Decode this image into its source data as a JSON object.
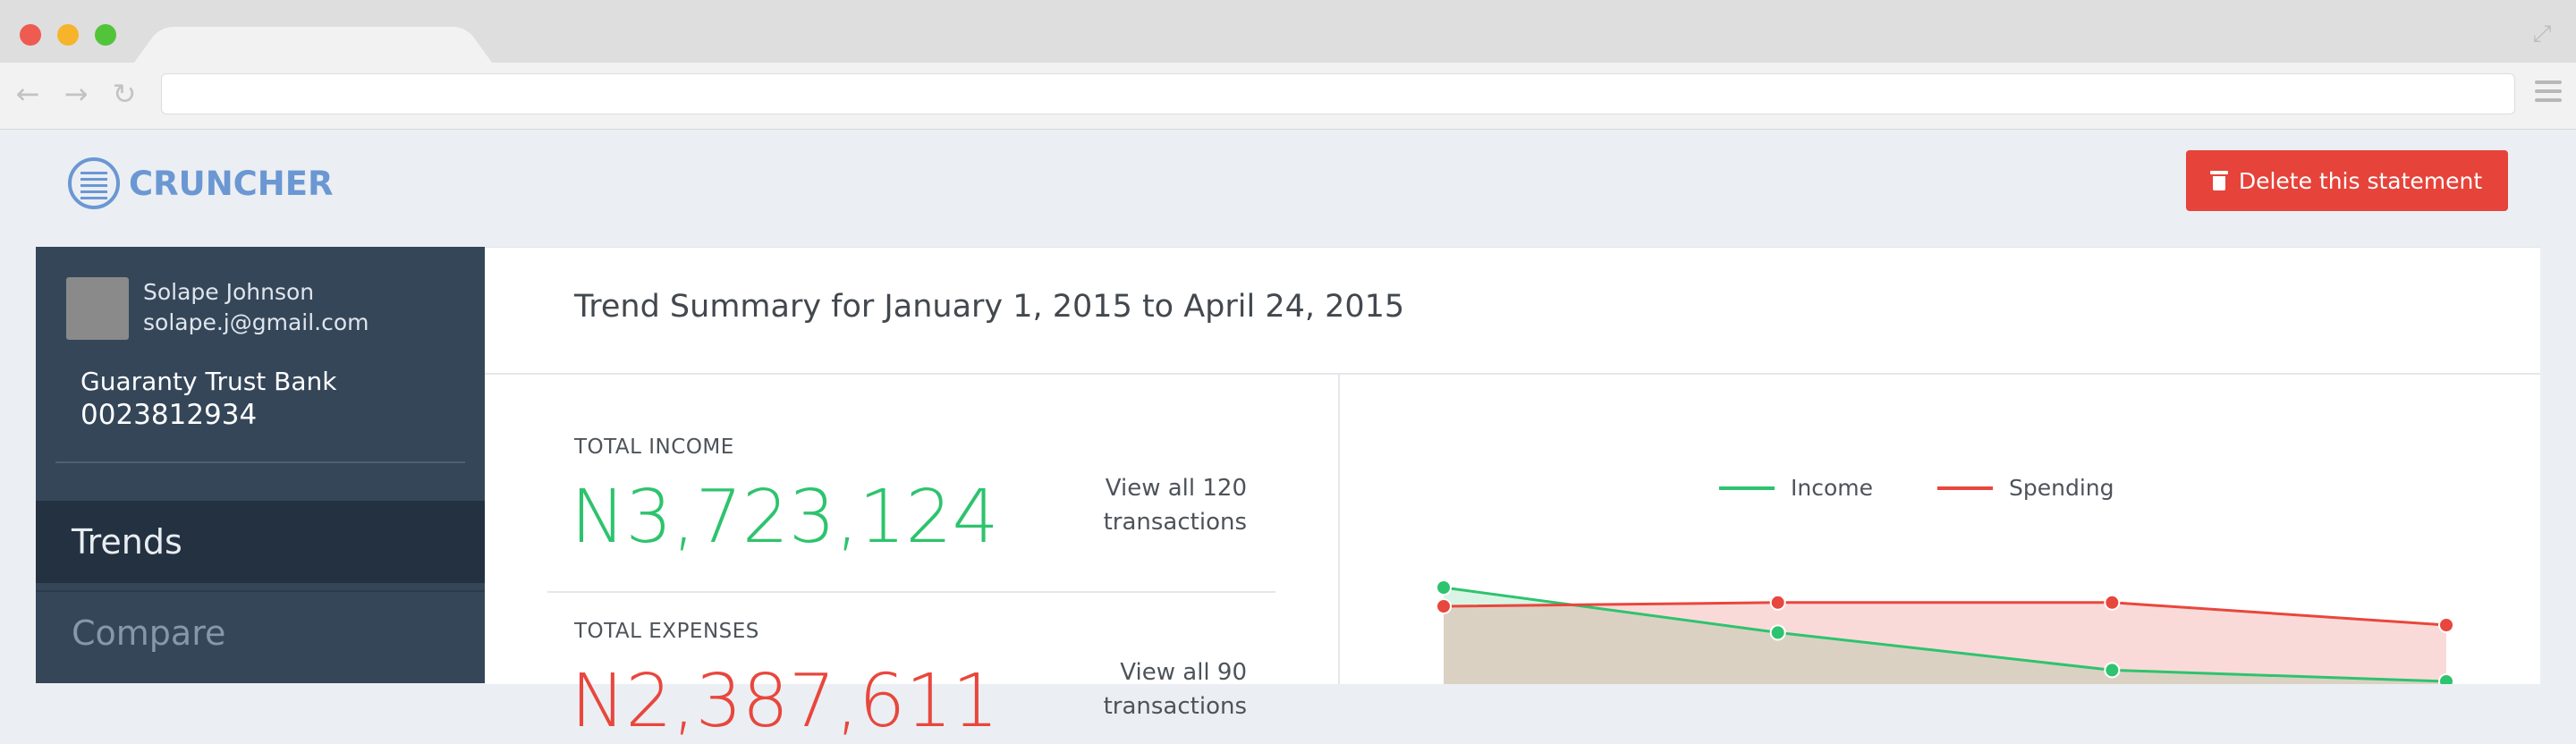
{
  "app": {
    "logo_text": "CRUNCHER"
  },
  "header": {
    "delete_label": "Delete this statement"
  },
  "sidebar": {
    "user_name": "Solape Johnson",
    "user_email": "solape.j@gmail.com",
    "bank_name": "Guaranty Trust Bank",
    "account_number": "0023812934",
    "nav": [
      {
        "label": "Trends",
        "active": true
      },
      {
        "label": "Compare",
        "active": false
      }
    ]
  },
  "main": {
    "title": "Trend Summary for January 1, 2015 to April 24, 2015",
    "income": {
      "label": "TOTAL INCOME",
      "value": "N3,723,124",
      "link_line1": "View all 120",
      "link_line2": "transactions"
    },
    "expenses": {
      "label": "TOTAL EXPENSES",
      "value": "N2,387,611",
      "link_line1": "View all 90",
      "link_line2": "transactions"
    }
  },
  "chart_data": {
    "type": "line",
    "series": [
      {
        "name": "Income",
        "color": "#2ec36e",
        "values": [
          100,
          88,
          78,
          75
        ]
      },
      {
        "name": "Spending",
        "color": "#e8473d",
        "values": [
          95,
          96,
          96,
          90
        ]
      }
    ],
    "legend": "top-center",
    "grid": false
  },
  "colors": {
    "income": "#2ec36e",
    "spending": "#e8473d",
    "brand": "#6b97d3",
    "danger": "#e6433a",
    "sidebar": "#354659"
  }
}
